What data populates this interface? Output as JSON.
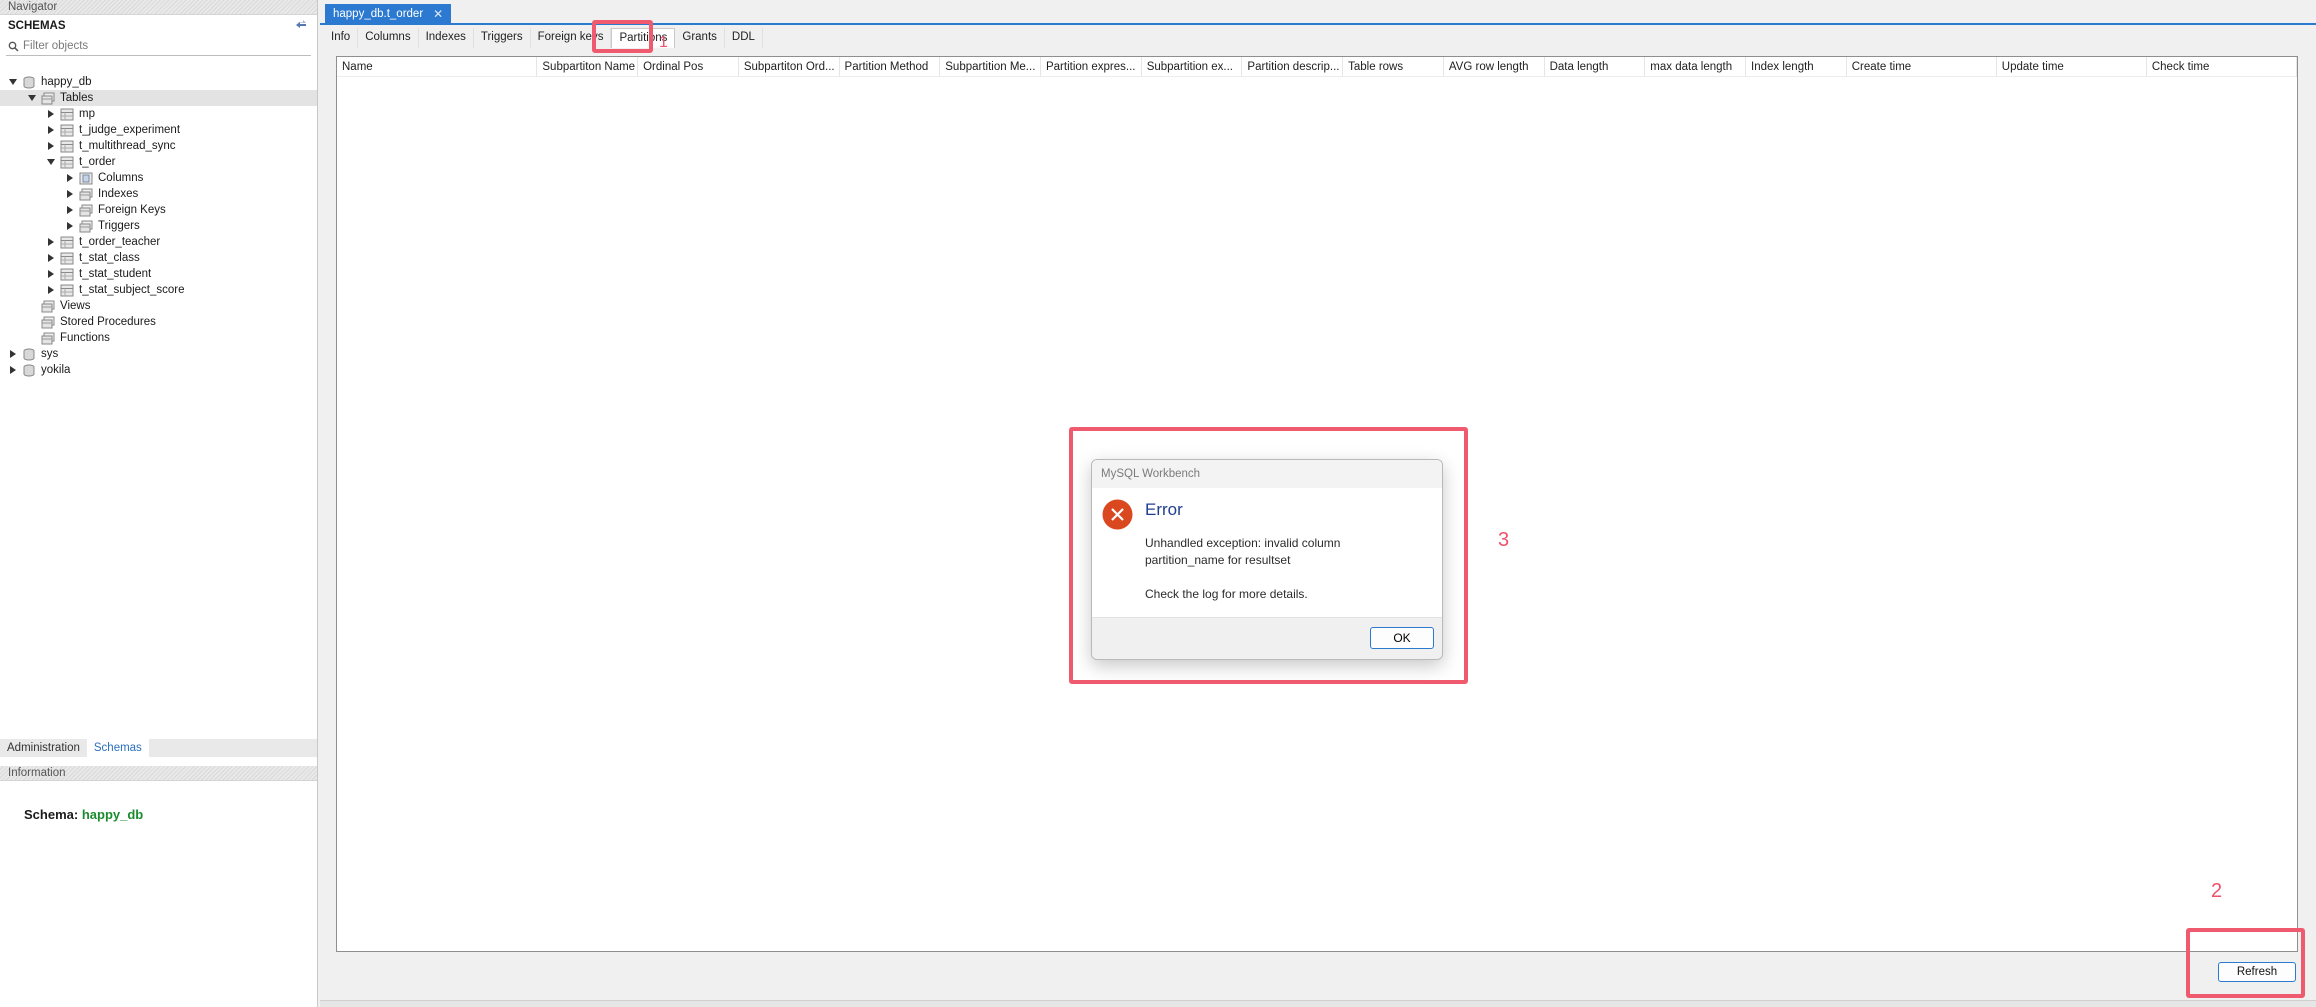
{
  "navigator": {
    "header": "Navigator",
    "schemas_label": "SCHEMAS",
    "filter_placeholder": "Filter objects",
    "tree": [
      {
        "label": "happy_db",
        "depth": 0,
        "arrow": "down",
        "icon": "database-icon",
        "selected": false
      },
      {
        "label": "Tables",
        "depth": 1,
        "arrow": "down",
        "icon": "folder-tables-icon",
        "selected": true
      },
      {
        "label": "mp",
        "depth": 2,
        "arrow": "right",
        "icon": "table-icon",
        "selected": false
      },
      {
        "label": "t_judge_experiment",
        "depth": 2,
        "arrow": "right",
        "icon": "table-icon",
        "selected": false
      },
      {
        "label": "t_multithread_sync",
        "depth": 2,
        "arrow": "right",
        "icon": "table-icon",
        "selected": false
      },
      {
        "label": "t_order",
        "depth": 2,
        "arrow": "down",
        "icon": "table-icon",
        "selected": false
      },
      {
        "label": "Columns",
        "depth": 3,
        "arrow": "right",
        "icon": "columns-icon",
        "selected": false
      },
      {
        "label": "Indexes",
        "depth": 3,
        "arrow": "right",
        "icon": "folder-icon",
        "selected": false
      },
      {
        "label": "Foreign Keys",
        "depth": 3,
        "arrow": "right",
        "icon": "folder-icon",
        "selected": false
      },
      {
        "label": "Triggers",
        "depth": 3,
        "arrow": "right",
        "icon": "folder-icon",
        "selected": false
      },
      {
        "label": "t_order_teacher",
        "depth": 2,
        "arrow": "right",
        "icon": "table-icon",
        "selected": false
      },
      {
        "label": "t_stat_class",
        "depth": 2,
        "arrow": "right",
        "icon": "table-icon",
        "selected": false
      },
      {
        "label": "t_stat_student",
        "depth": 2,
        "arrow": "right",
        "icon": "table-icon",
        "selected": false
      },
      {
        "label": "t_stat_subject_score",
        "depth": 2,
        "arrow": "right",
        "icon": "table-icon",
        "selected": false
      },
      {
        "label": "Views",
        "depth": 1,
        "arrow": "none",
        "icon": "folder-icon",
        "selected": false
      },
      {
        "label": "Stored Procedures",
        "depth": 1,
        "arrow": "none",
        "icon": "folder-icon",
        "selected": false
      },
      {
        "label": "Functions",
        "depth": 1,
        "arrow": "none",
        "icon": "folder-icon",
        "selected": false
      },
      {
        "label": "sys",
        "depth": 0,
        "arrow": "right",
        "icon": "database-icon",
        "selected": false
      },
      {
        "label": "yokila",
        "depth": 0,
        "arrow": "right",
        "icon": "database-icon",
        "selected": false
      }
    ],
    "bottom_tabs": [
      {
        "label": "Administration",
        "active": false
      },
      {
        "label": "Schemas",
        "active": true
      }
    ],
    "info_header": "Information",
    "info_schema_label": "Schema:",
    "info_schema_value": "happy_db"
  },
  "editor": {
    "doc_tab": "happy_db.t_order",
    "subtabs": [
      {
        "label": "Info",
        "active": false
      },
      {
        "label": "Columns",
        "active": false
      },
      {
        "label": "Indexes",
        "active": false
      },
      {
        "label": "Triggers",
        "active": false
      },
      {
        "label": "Foreign keys",
        "active": false
      },
      {
        "label": "Partitions",
        "active": true
      },
      {
        "label": "Grants",
        "active": false
      },
      {
        "label": "DDL",
        "active": false
      }
    ],
    "columns": [
      "Name",
      "Subpartiton Name",
      "Ordinal Pos",
      "Subpartiton Ord...",
      "Partition Method",
      "Subpartition Me...",
      "Partition expres...",
      "Subpartition ex...",
      "Partition descrip...",
      "Table rows",
      "AVG row length",
      "Data length",
      "max data length",
      "Index length",
      "Create time",
      "Update time",
      "Check time"
    ],
    "refresh_label": "Refresh"
  },
  "dialog": {
    "title": "MySQL Workbench",
    "heading": "Error",
    "message": "Unhandled exception: invalid column partition_name for resultset",
    "message2": "Check the log for more details.",
    "ok_label": "OK"
  },
  "annotations": {
    "label1": "1",
    "label2": "2",
    "label3": "3",
    "color": "#f05a6e"
  }
}
